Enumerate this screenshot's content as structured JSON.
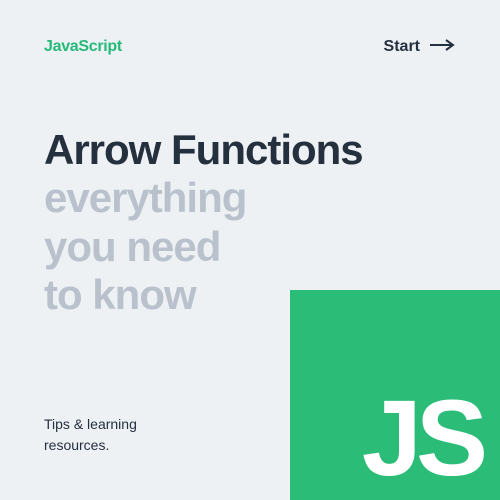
{
  "header": {
    "brand": "JavaScript",
    "start_label": "Start"
  },
  "hero": {
    "title_main": "Arrow Functions",
    "subtitle_line1": "everything",
    "subtitle_line2": "you need",
    "subtitle_line3": "to know"
  },
  "footer": {
    "tagline": "Tips & learning resources."
  },
  "badge": {
    "text": "JS"
  },
  "colors": {
    "accent": "#26b97a",
    "badge_bg": "#2bbd77",
    "text_dark": "#25303f",
    "text_muted": "#b9c2cc",
    "page_bg": "#eef1f4"
  }
}
